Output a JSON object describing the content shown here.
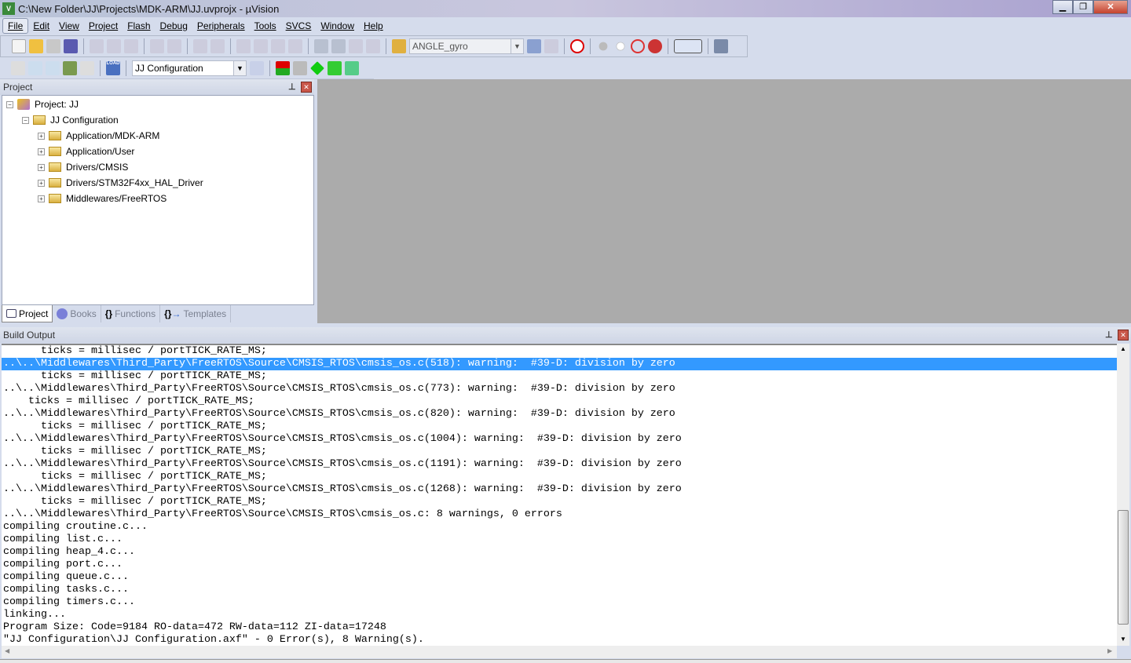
{
  "window": {
    "title": "C:\\New Folder\\JJ\\Projects\\MDK-ARM\\JJ.uvprojx - µVision",
    "icon": "uv-icon"
  },
  "menu": [
    "File",
    "Edit",
    "View",
    "Project",
    "Flash",
    "Debug",
    "Peripherals",
    "Tools",
    "SVCS",
    "Window",
    "Help"
  ],
  "toolbar": {
    "target_combo": "ANGLE_gyro",
    "config_combo": "JJ Configuration",
    "load_label": "LOAD"
  },
  "project_panel": {
    "title": "Project",
    "tree": {
      "root": "Project: JJ",
      "config": "JJ Configuration",
      "groups": [
        "Application/MDK-ARM",
        "Application/User",
        "Drivers/CMSIS",
        "Drivers/STM32F4xx_HAL_Driver",
        "Middlewares/FreeRTOS"
      ]
    },
    "tabs": [
      "Project",
      "Books",
      "Functions",
      "Templates"
    ]
  },
  "build_output": {
    "title": "Build Output",
    "selected_index": 1,
    "lines": [
      "      ticks = millisec / portTICK_RATE_MS;",
      "..\\..\\Middlewares\\Third_Party\\FreeRTOS\\Source\\CMSIS_RTOS\\cmsis_os.c(518): warning:  #39-D: division by zero",
      "      ticks = millisec / portTICK_RATE_MS;",
      "..\\..\\Middlewares\\Third_Party\\FreeRTOS\\Source\\CMSIS_RTOS\\cmsis_os.c(773): warning:  #39-D: division by zero",
      "    ticks = millisec / portTICK_RATE_MS;",
      "..\\..\\Middlewares\\Third_Party\\FreeRTOS\\Source\\CMSIS_RTOS\\cmsis_os.c(820): warning:  #39-D: division by zero",
      "      ticks = millisec / portTICK_RATE_MS;",
      "..\\..\\Middlewares\\Third_Party\\FreeRTOS\\Source\\CMSIS_RTOS\\cmsis_os.c(1004): warning:  #39-D: division by zero",
      "      ticks = millisec / portTICK_RATE_MS;",
      "..\\..\\Middlewares\\Third_Party\\FreeRTOS\\Source\\CMSIS_RTOS\\cmsis_os.c(1191): warning:  #39-D: division by zero",
      "      ticks = millisec / portTICK_RATE_MS;",
      "..\\..\\Middlewares\\Third_Party\\FreeRTOS\\Source\\CMSIS_RTOS\\cmsis_os.c(1268): warning:  #39-D: division by zero",
      "      ticks = millisec / portTICK_RATE_MS;",
      "..\\..\\Middlewares\\Third_Party\\FreeRTOS\\Source\\CMSIS_RTOS\\cmsis_os.c: 8 warnings, 0 errors",
      "compiling croutine.c...",
      "compiling list.c...",
      "compiling heap_4.c...",
      "compiling port.c...",
      "compiling queue.c...",
      "compiling tasks.c...",
      "compiling timers.c...",
      "linking...",
      "Program Size: Code=9184 RO-data=472 RW-data=112 ZI-data=17248",
      "\"JJ Configuration\\JJ Configuration.axf\" - 0 Error(s), 8 Warning(s)."
    ]
  },
  "colors": {
    "selection": "#3399ff",
    "workspace": "#ababab",
    "chrome": "#d5dcec"
  }
}
